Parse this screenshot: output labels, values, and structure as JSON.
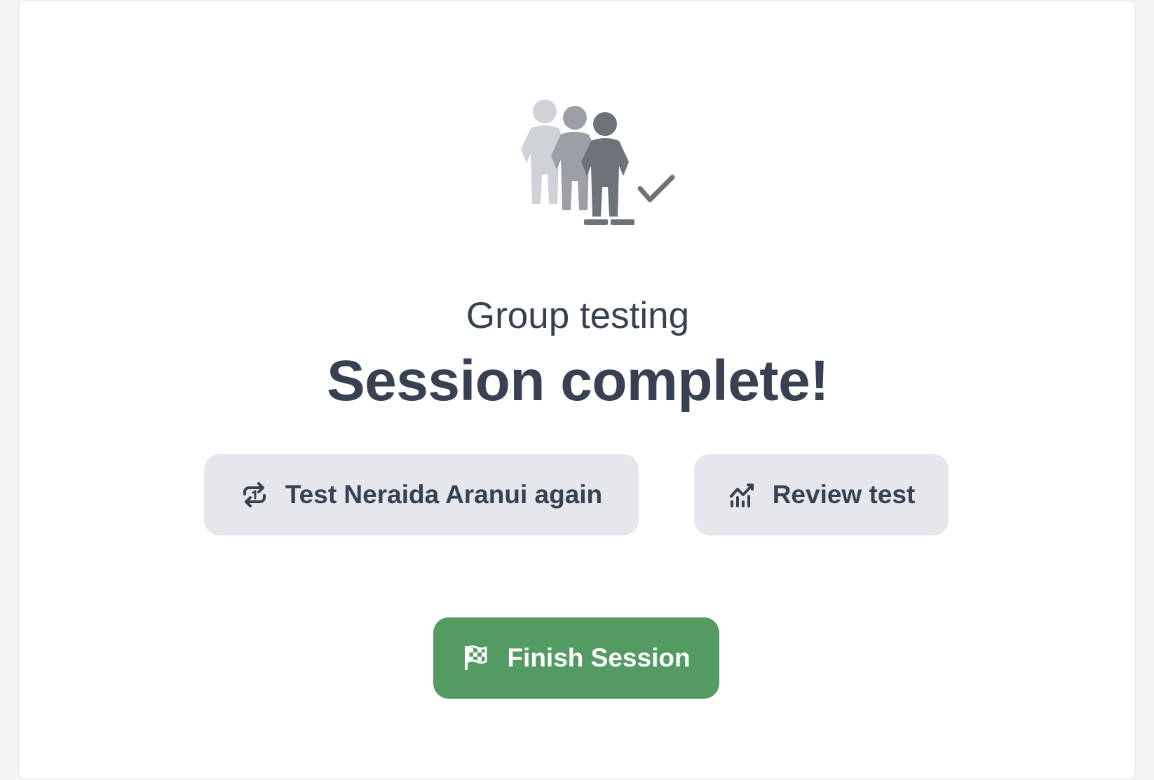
{
  "header": {
    "subtitle": "Group testing",
    "title": "Session complete!"
  },
  "illustration": {
    "icon": "group-people-check-icon"
  },
  "actions": {
    "test_again": {
      "label": "Test Neraida Aranui again",
      "icon": "repeat-icon"
    },
    "review": {
      "label": "Review test",
      "icon": "chart-line-icon"
    },
    "finish": {
      "label": "Finish Session",
      "icon": "checkered-flag-icon"
    }
  },
  "colors": {
    "primary": "#539b63",
    "secondary_bg": "#e5e7eb",
    "text": "#374151"
  }
}
